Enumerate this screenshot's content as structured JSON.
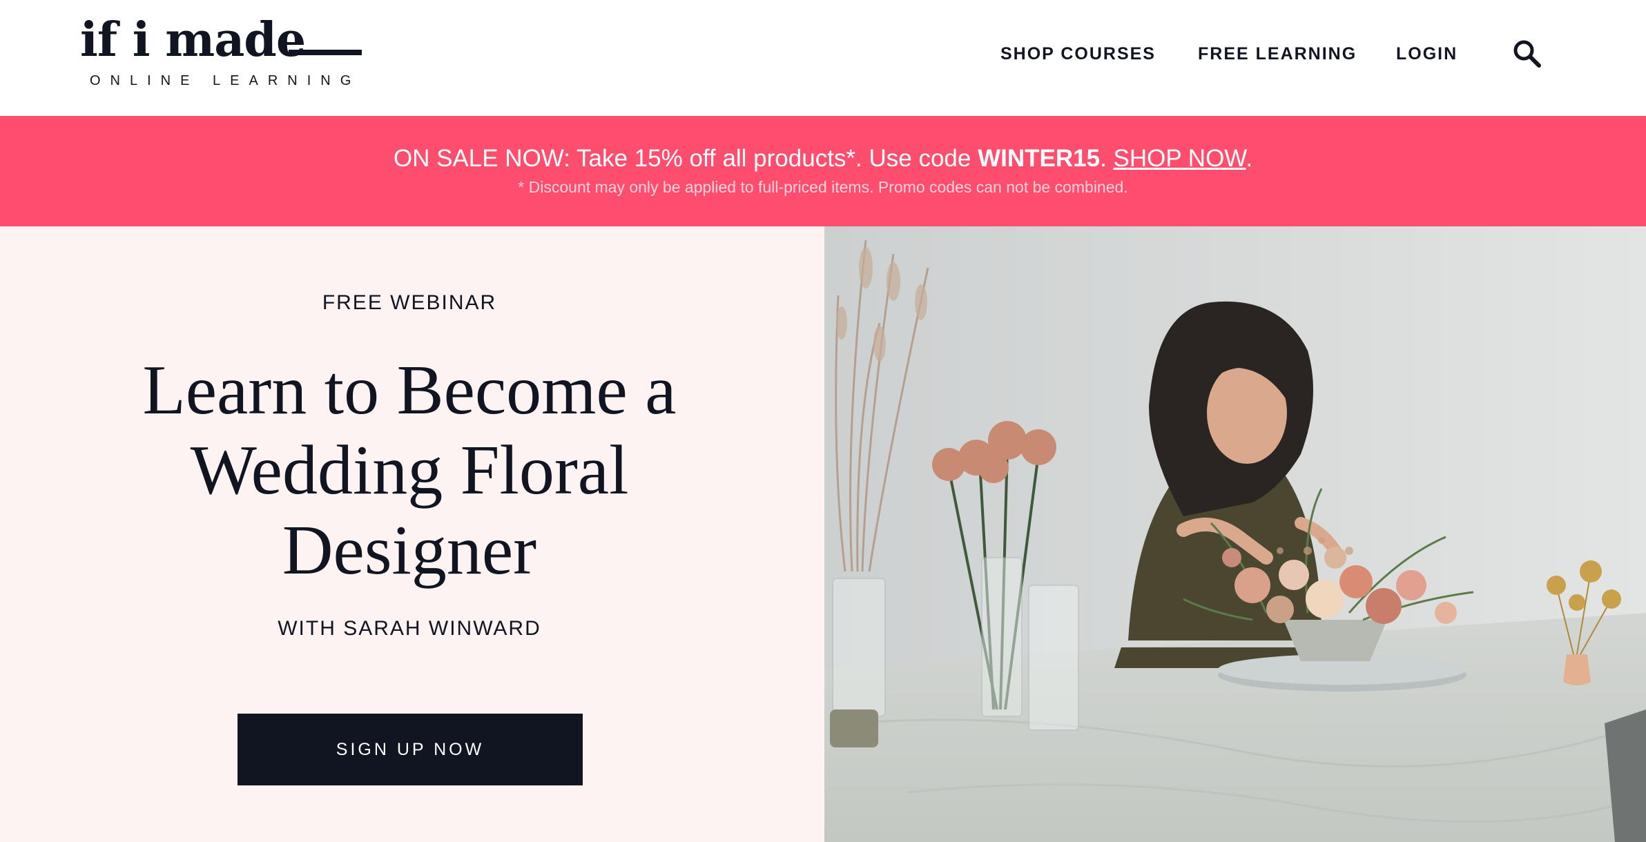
{
  "brand": {
    "logo_main": "if i made",
    "logo_sub": "ONLINE LEARNING"
  },
  "nav": {
    "shop_courses": "SHOP COURSES",
    "free_learning": "FREE LEARNING",
    "login": "LOGIN",
    "search_icon": "search-icon"
  },
  "promo": {
    "prefix": "ON SALE NOW: Take 15% off all products*. Use code ",
    "code": "WINTER15",
    "separator": ".  ",
    "link": "SHOP NOW",
    "suffix": ".",
    "note": "* Discount may only be applied to full-priced items. Promo codes can not be combined."
  },
  "hero": {
    "eyebrow": "FREE WEBINAR",
    "title_line1": "Learn to Become a",
    "title_line2": "Wedding Floral",
    "title_line3": "Designer",
    "byline": "WITH SARAH WINWARD",
    "cta": "SIGN UP NOW"
  },
  "colors": {
    "promo_bg": "#ff4d6d",
    "hero_bg": "#fcf3f2",
    "ink": "#111521",
    "white": "#ffffff"
  }
}
